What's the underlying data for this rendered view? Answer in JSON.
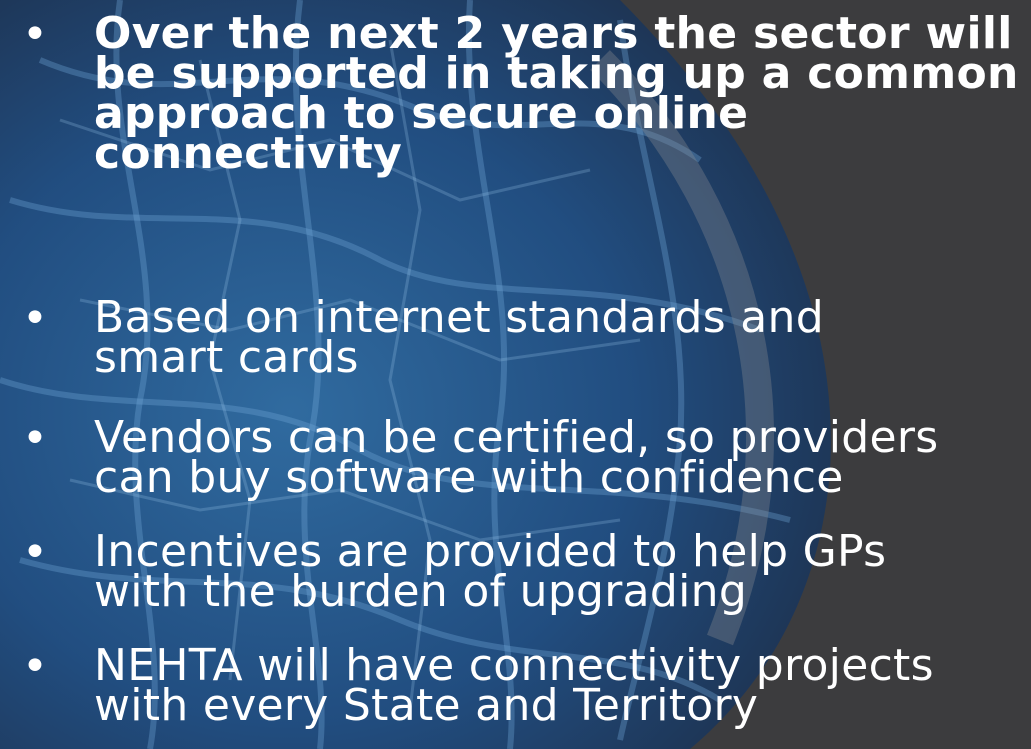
{
  "slide": {
    "background_color": "#3c3c3e",
    "text_color": "#ffffff",
    "bullet_glyph": "•",
    "bullets": [
      {
        "text": "Over the next 2 years the sector will be supported in taking up a common approach to secure online connectivity",
        "emphasis": "bold"
      },
      {
        "text": "Based on internet standards and smart cards",
        "emphasis": "normal"
      },
      {
        "text": "Vendors can be certified, so providers can buy software with confidence",
        "emphasis": "normal"
      },
      {
        "text": "Incentives are provided to help GPs with the burden of upgrading",
        "emphasis": "normal"
      },
      {
        "text": "NEHTA will have connectivity projects with every State and Territory",
        "emphasis": "normal"
      }
    ]
  }
}
